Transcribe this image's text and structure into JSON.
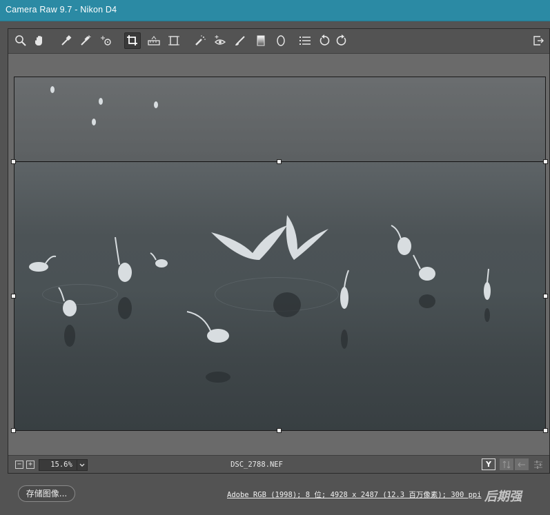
{
  "window": {
    "title": "Camera Raw 9.7 -  Nikon D4"
  },
  "toolbar": {
    "tools": [
      {
        "name": "zoom-tool-icon"
      },
      {
        "name": "hand-tool-icon"
      },
      {
        "name": "white-balance-tool-icon"
      },
      {
        "name": "color-sampler-tool-icon"
      },
      {
        "name": "targeted-adjustment-tool-icon"
      },
      {
        "name": "crop-tool-icon",
        "active": true
      },
      {
        "name": "straighten-tool-icon"
      },
      {
        "name": "transform-tool-icon"
      },
      {
        "name": "spot-removal-tool-icon"
      },
      {
        "name": "red-eye-removal-icon"
      },
      {
        "name": "adjustment-brush-icon"
      },
      {
        "name": "graduated-filter-icon"
      },
      {
        "name": "radial-filter-icon"
      },
      {
        "name": "preferences-icon"
      },
      {
        "name": "rotate-ccw-icon"
      },
      {
        "name": "rotate-cw-icon"
      }
    ]
  },
  "status": {
    "zoom_out": "−",
    "zoom_in": "+",
    "zoom_value": "15.6%",
    "filename": "DSC_2788.NEF",
    "before_after_label": "Y"
  },
  "footer": {
    "save_label": "存储图像...",
    "workflow_options": "Adobe RGB (1998); 8 位; 4928 x 2487 (12.3 百万像素); 300 ppi",
    "watermark": "后期强"
  },
  "colors": {
    "titlebar": "#2b8aa4",
    "panel": "#535353",
    "canvas": "#6a6a6a"
  }
}
